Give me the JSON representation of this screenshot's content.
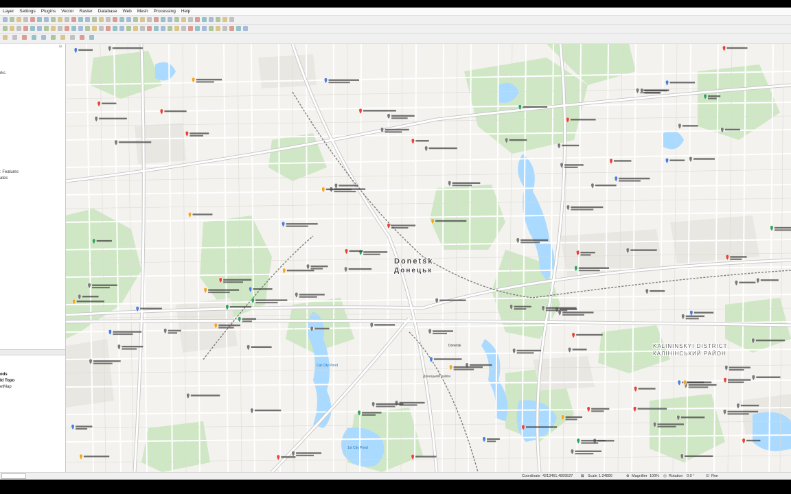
{
  "menus": [
    "Layer",
    "Settings",
    "Plugins",
    "Vector",
    "Raster",
    "Database",
    "Web",
    "Mesh",
    "Processing",
    "Help"
  ],
  "left_panel": {
    "top_lines": [
      "rks",
      ": Features",
      "ates"
    ],
    "bottom_lines": [
      "ods",
      "ld Topo",
      "etMap"
    ]
  },
  "map": {
    "city_label_en": "Donetsk",
    "city_label_ru": "Донецьк",
    "district_label_en": "KALININSKYI DISTRICT",
    "district_label_ru": "КАЛІНІНСЬКИЙ РАЙОН",
    "pond_label_1": "Cat City Pond",
    "pond_label_2": "1st City Pond",
    "district_admin_label": "Донецький район",
    "place_label": "Donetsk"
  },
  "statusbar": {
    "coordinate_label": "Coordinate",
    "coordinate_value": "4213461,4899527",
    "scale_label": "Scale",
    "scale_value": "1:24896",
    "magnifier_label": "Magnifier",
    "magnifier_value": "100%",
    "rotation_label": "Rotation",
    "rotation_value": "0.0 °",
    "render_label": "Ren"
  },
  "colors": {
    "map_bg": "#f3f2ee",
    "water": "#aadaff",
    "park": "#cfe7c4",
    "road": "#ffffff",
    "road_casing": "#c9c9c9",
    "rail": "#7d7d7d",
    "poi_red": "#ea4335",
    "poi_orange": "#f4a41d",
    "poi_blue": "#4a7fe0",
    "poi_green": "#2ea45a",
    "poi_gray": "#7a7a7a"
  }
}
